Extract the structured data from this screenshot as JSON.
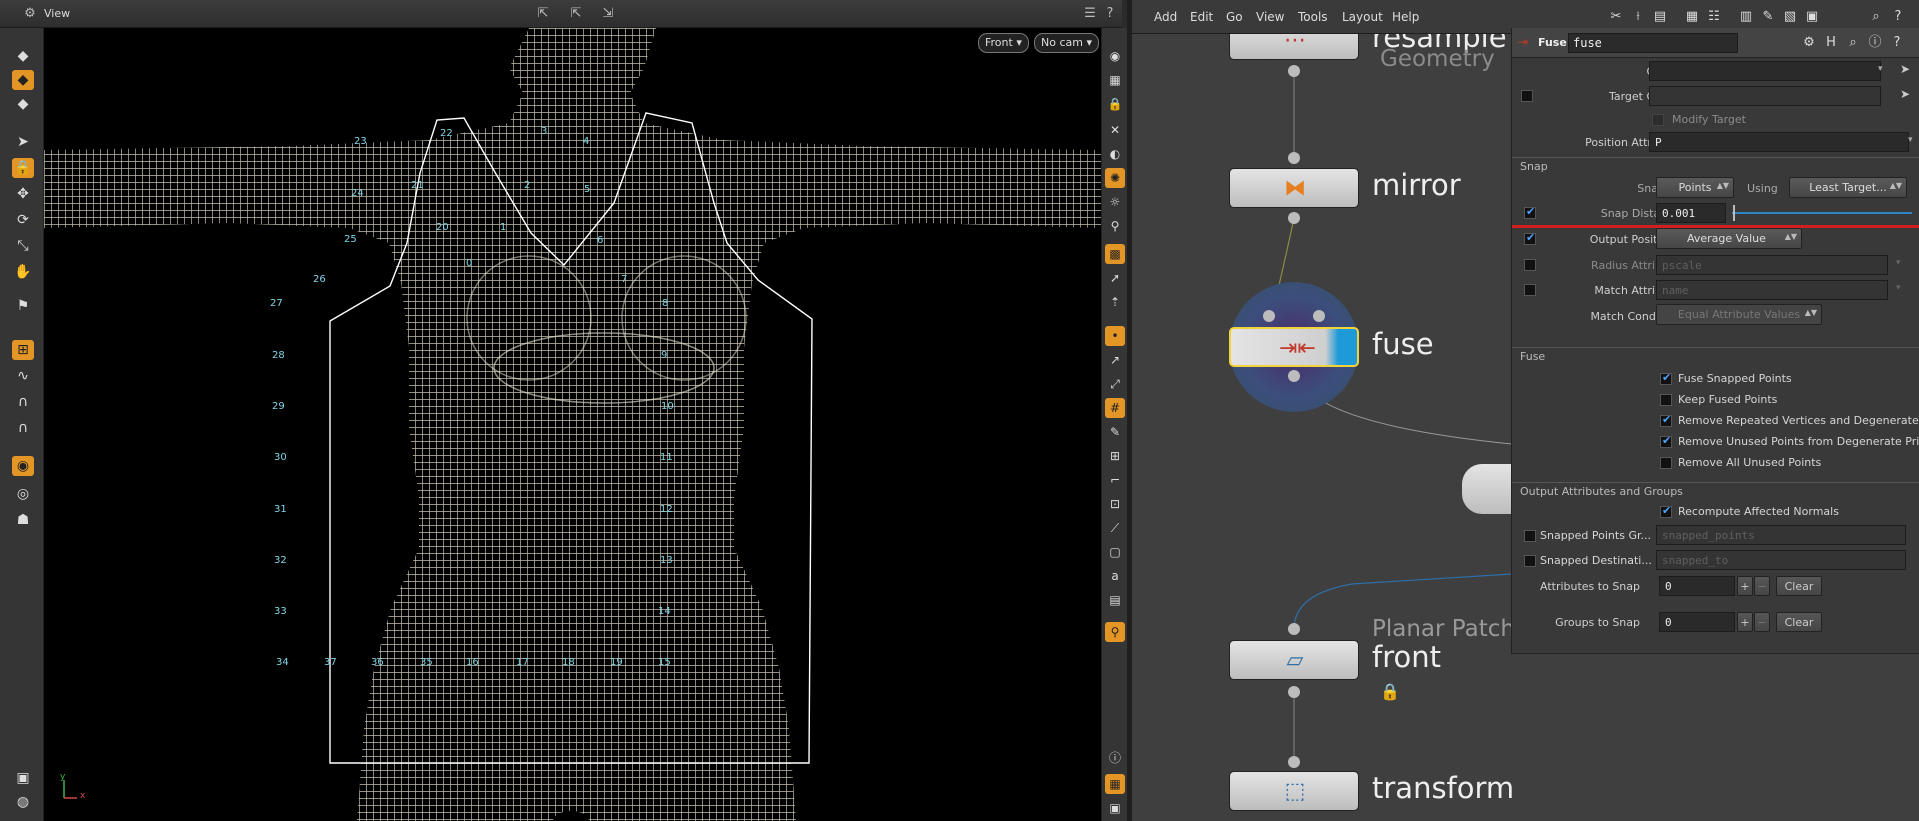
{
  "viewport": {
    "title": "View",
    "camera_view": "Front",
    "camera": "No cam",
    "axis_y": "y",
    "axis_x": "x",
    "point_labels": [
      "22",
      "23",
      "3",
      "4",
      "24",
      "5",
      "25",
      "6",
      "26",
      "7",
      "27",
      "8",
      "28",
      "9",
      "29",
      "10",
      "30",
      "11",
      "31",
      "12",
      "32",
      "13",
      "33",
      "14",
      "34",
      "15",
      "37",
      "36",
      "35",
      "16",
      "17",
      "18",
      "19",
      "20",
      "21",
      "1",
      "2",
      "0"
    ]
  },
  "menubar": {
    "items": [
      "Add",
      "Edit",
      "Go",
      "View",
      "Tools",
      "Layout",
      "Help"
    ]
  },
  "network": {
    "nodes": [
      {
        "name": "resample",
        "subtitle": "Geometry",
        "icon": "resample-icon"
      },
      {
        "name": "mirror",
        "subtitle": "",
        "icon": "mirror-icon"
      },
      {
        "name": "fuse",
        "subtitle": "",
        "icon": "fuse-icon"
      },
      {
        "name": "front",
        "subtitle": "Planar Patch",
        "icon": "planar-patch-icon"
      },
      {
        "name": "transform",
        "subtitle": "",
        "icon": "transform-icon"
      }
    ]
  },
  "params": {
    "node_type": "Fuse",
    "node_name": "fuse",
    "group_label": "Group",
    "group_value": "",
    "target_group_label": "Target Group",
    "modify_target_label": "Modify Target",
    "position_attr_label": "Position Attribute",
    "position_attr_value": "P",
    "snap_section": "Snap",
    "snap_to_label": "Snap To",
    "snap_to_value": "Points",
    "using_label": "Using",
    "using_value": "Least Target...",
    "snap_distance_label": "Snap Distance",
    "snap_distance_value": "0.001",
    "output_positions_label": "Output Positions",
    "output_positions_value": "Average Value",
    "radius_attr_label": "Radius Attribute",
    "radius_attr_value": "pscale",
    "match_attr_label": "Match Attribute",
    "match_attr_value": "name",
    "match_condition_label": "Match Condition",
    "match_condition_value": "Equal Attribute Values",
    "fuse_section": "Fuse",
    "fuse_snapped": "Fuse Snapped Points",
    "keep_fused": "Keep Fused Points",
    "remove_repeated": "Remove Repeated Vertices and Degenerate...",
    "remove_unused": "Remove Unused Points from Degenerate Pri...",
    "remove_all_unused": "Remove All Unused Points",
    "output_section": "Output Attributes and Groups",
    "recompute_normals": "Recompute Affected Normals",
    "snapped_points_label": "Snapped Points Gr...",
    "snapped_points_value": "snapped_points",
    "snapped_dest_label": "Snapped Destinati...",
    "snapped_dest_value": "snapped_to",
    "attrs_to_snap_label": "Attributes to Snap",
    "attrs_to_snap_value": "0",
    "groups_to_snap_label": "Groups to Snap",
    "groups_to_snap_value": "0",
    "clear_label": "Clear",
    "plus": "+",
    "minus": "−"
  }
}
